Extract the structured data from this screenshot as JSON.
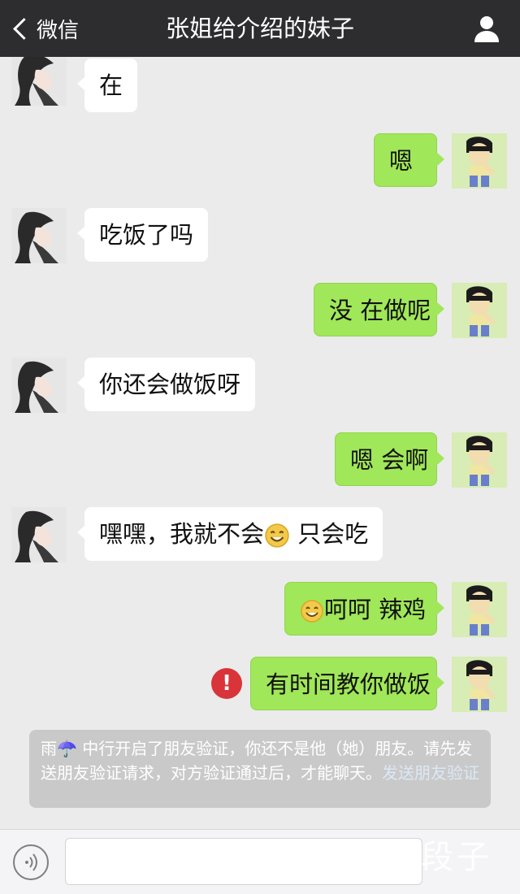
{
  "navbar": {
    "back_label": "微信",
    "title": "张姐给介绍的妹子"
  },
  "messages": [
    {
      "side": "left",
      "text": "在"
    },
    {
      "side": "right",
      "text": "嗯"
    },
    {
      "side": "left",
      "text": "吃饭了吗"
    },
    {
      "side": "right",
      "text": "没 在做呢"
    },
    {
      "side": "left",
      "text": "你还会做饭呀"
    },
    {
      "side": "right",
      "text": "嗯 会啊"
    },
    {
      "side": "left",
      "text_before": "嘿嘿，我就不会",
      "emoji": "smile-emoji",
      "text_after": " 只会吃"
    },
    {
      "side": "right",
      "emoji": "smile-emoji",
      "text": "呵呵 辣鸡"
    },
    {
      "side": "right",
      "text": "有时间教你做饭",
      "failed": true,
      "failed_icon": "!"
    }
  ],
  "system_message": {
    "text": "雨☂️ 中行开启了朋友验证，你还不是他（她）朋友。请先发送朋友验证请求，对方验证通过后，才能聊天。",
    "link": "发送朋友验证"
  },
  "input": {
    "placeholder": ""
  },
  "watermark": "内涵段子",
  "colors": {
    "navbar": "#2d2d30",
    "bubble_right": "#a0e759",
    "bubble_left": "#ffffff",
    "background": "#ebebeb",
    "error": "#d8343a"
  },
  "icons": {
    "back": "chevron-left-icon",
    "profile": "person-icon",
    "voice": "voice-icon",
    "failed": "exclamation-icon"
  }
}
